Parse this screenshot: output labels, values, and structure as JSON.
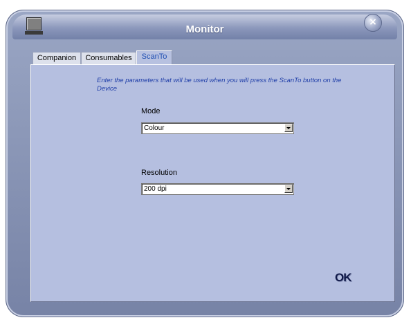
{
  "window": {
    "title": "Monitor",
    "close_icon": "close-icon",
    "app_icon": "monitor-icon"
  },
  "tabs": [
    {
      "label": "Companion",
      "active": false
    },
    {
      "label": "Consumables",
      "active": false
    },
    {
      "label": "ScanTo",
      "active": true
    }
  ],
  "scanto": {
    "instructions": "Enter the parameters that will be used when you will press the ScanTo button on the Device",
    "mode": {
      "label": "Mode",
      "value": "Colour"
    },
    "resolution": {
      "label": "Resolution",
      "value": "200 dpi"
    },
    "ok_label": "OK"
  },
  "colors": {
    "panel": "#b5bfe0",
    "window_frame": "#8b97bb",
    "instruction_text": "#1f3ea8",
    "active_tab_text": "#1f4fb2"
  }
}
